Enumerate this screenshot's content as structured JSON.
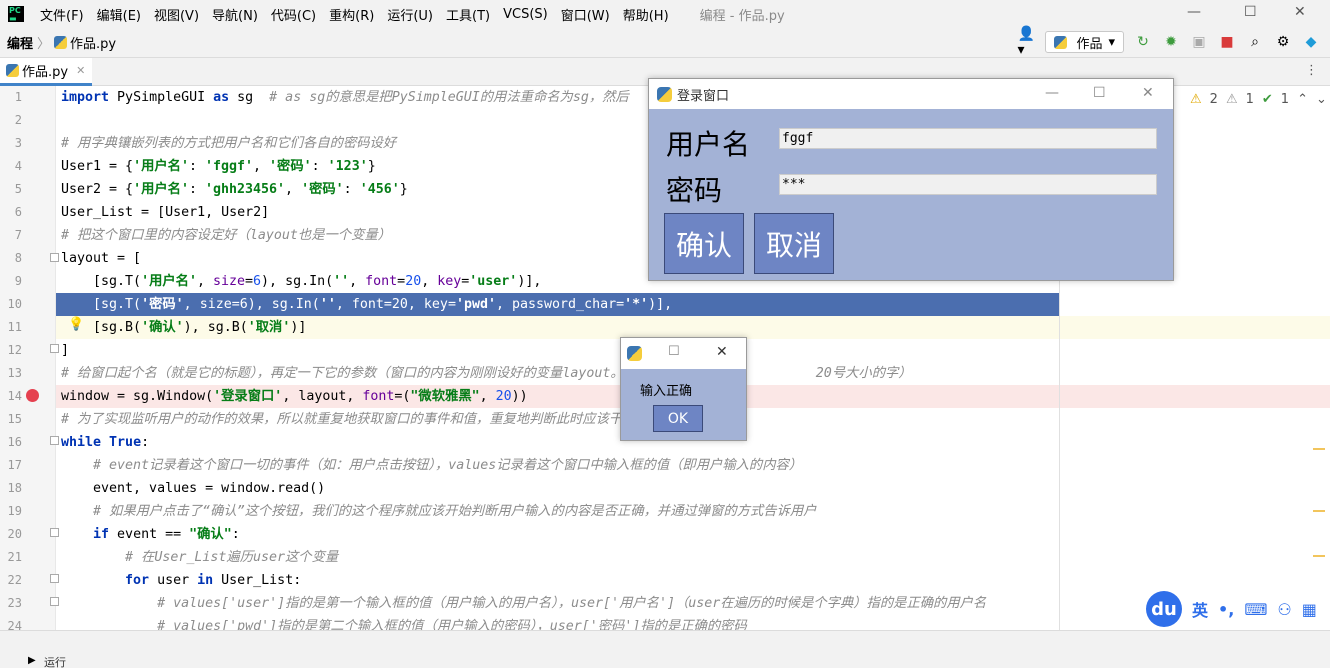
{
  "menubar": {
    "items": [
      "文件(F)",
      "编辑(E)",
      "视图(V)",
      "导航(N)",
      "代码(C)",
      "重构(R)",
      "运行(U)",
      "工具(T)",
      "VCS(S)",
      "窗口(W)",
      "帮助(H)"
    ],
    "window_title": "编程 - 作品.py",
    "controls": {
      "minimize": "—",
      "maximize": "☐",
      "close": "✕"
    }
  },
  "navbar": {
    "project": "编程",
    "file": "作品.py",
    "run_config": "作品"
  },
  "tab": {
    "label": "作品.py"
  },
  "inspections": {
    "warnings_a": "2",
    "warnings_b": "1",
    "ok": "1"
  },
  "code_lines": [
    {
      "n": "1"
    },
    {
      "n": "2"
    },
    {
      "n": "3"
    },
    {
      "n": "4"
    },
    {
      "n": "5"
    },
    {
      "n": "6"
    },
    {
      "n": "7"
    },
    {
      "n": "8"
    },
    {
      "n": "9"
    },
    {
      "n": "10"
    },
    {
      "n": "11"
    },
    {
      "n": "12"
    },
    {
      "n": "13"
    },
    {
      "n": "14"
    },
    {
      "n": "15"
    },
    {
      "n": "16"
    },
    {
      "n": "17"
    },
    {
      "n": "18"
    },
    {
      "n": "19"
    },
    {
      "n": "20"
    },
    {
      "n": "21"
    },
    {
      "n": "22"
    },
    {
      "n": "23"
    },
    {
      "n": "24"
    }
  ],
  "code": {
    "l1_kw1": "import",
    "l1_mod": " PySimpleGUI ",
    "l1_kw2": "as",
    "l1_alias": " sg  ",
    "l1_cm": "# as sg的意思是把PySimpleGUI的用法重命名为sg，然后",
    "l3_cm": "# 用字典镶嵌列表的方式把用户名和它们各自的密码设好",
    "l4_a": "User1 = {",
    "l4_s1": "'用户名'",
    "l4_b": ": ",
    "l4_s2": "'fggf'",
    "l4_c": ", ",
    "l4_s3": "'密码'",
    "l4_d": ": ",
    "l4_s4": "'123'",
    "l4_e": "}",
    "l5_a": "User2 = {",
    "l5_s1": "'用户名'",
    "l5_b": ": ",
    "l5_s2": "'ghh23456'",
    "l5_c": ", ",
    "l5_s3": "'密码'",
    "l5_d": ": ",
    "l5_s4": "'456'",
    "l5_e": "}",
    "l6": "User_List = [User1, User2]",
    "l7_cm": "# 把这个窗口里的内容设定好（layout也是一个变量）",
    "l8": "layout = [",
    "l9_a": "    [sg.T(",
    "l9_s1": "'用户名'",
    "l9_b": ", ",
    "l9_k1": "size",
    "l9_c": "=",
    "l9_n1": "6",
    "l9_d": "), sg.In(",
    "l9_s2": "''",
    "l9_e": ", ",
    "l9_k2": "font",
    "l9_f": "=",
    "l9_n2": "20",
    "l9_g": ", ",
    "l9_k3": "key",
    "l9_h": "=",
    "l9_s3": "'user'",
    "l9_i": ")],",
    "l10_a": "    [sg.T(",
    "l10_s1": "'密码'",
    "l10_b": ", ",
    "l10_k1": "size",
    "l10_c": "=",
    "l10_n1": "6",
    "l10_d": "), sg.In(",
    "l10_s2": "''",
    "l10_e": ", ",
    "l10_k2": "font",
    "l10_f": "=",
    "l10_n2": "20",
    "l10_g": ", ",
    "l10_k3": "key",
    "l10_h": "=",
    "l10_s3": "'pwd'",
    "l10_i": ", ",
    "l10_k4": "password_char",
    "l10_j": "=",
    "l10_s4": "'*'",
    "l10_l": ")],",
    "l11_a": "    [sg.B(",
    "l11_s1": "'确认'",
    "l11_b": "), sg.B(",
    "l11_s2": "'取消'",
    "l11_c": ")]",
    "l12": "]",
    "l13_cm": "# 给窗口起个名（就是它的标题），再定一下它的参数（窗口的内容为刚刚设好的变量layout。                        20号大小的字）",
    "l14_a": "window = sg.Window(",
    "l14_s1": "'登录窗口'",
    "l14_b": ", layout, ",
    "l14_k1": "font",
    "l14_c": "=(",
    "l14_s2": "\"微软雅黑\"",
    "l14_d": ", ",
    "l14_n1": "20",
    "l14_e": "))",
    "l15_cm": "# 为了实现监听用户的动作的效果，所以就重复地获取窗口的事件和值，重复地判断此时应该干",
    "l16_kw1": "while",
    "l16_sp": " ",
    "l16_kw2": "True",
    "l16_e": ":",
    "l17_cm": "    # event记录着这个窗口一切的事件（如：用户点击按钮），values记录着这个窗口中输入框的值（即用户输入的内容）",
    "l18": "    event, values = window.read()",
    "l19_cm": "    # 如果用户点击了“确认”这个按钮，我们的这个程序就应该开始判断用户输入的内容是否正确，并通过弹窗的方式告诉用户",
    "l20_a": "    ",
    "l20_kw": "if",
    "l20_b": " event == ",
    "l20_s": "\"确认\"",
    "l20_c": ":",
    "l21_cm": "        # 在User_List遍历user这个变量",
    "l22_a": "        ",
    "l22_kw1": "for",
    "l22_b": " user ",
    "l22_kw2": "in",
    "l22_c": " User_List:",
    "l23_cm": "            # values['user']指的是第一个输入框的值（用户输入的用户名），user['用户名']（user在遍历的时候是个字典）指的是正确的用户名",
    "l24_cm": "            # values['pwd']指的是第二个输入框的值（用户输入的密码），user['密码']指的是正确的密码"
  },
  "login_window": {
    "title": "登录窗口",
    "username_label": "用户名",
    "username_value": "fggf",
    "password_label": "密码",
    "password_value": "***",
    "confirm_button": "确认",
    "cancel_button": "取消"
  },
  "popup": {
    "message": "输入正确",
    "ok_button": "OK"
  },
  "ime": {
    "brand": "du",
    "lang": "英",
    "punct": "•,"
  },
  "runbar": {
    "label": "运行"
  }
}
